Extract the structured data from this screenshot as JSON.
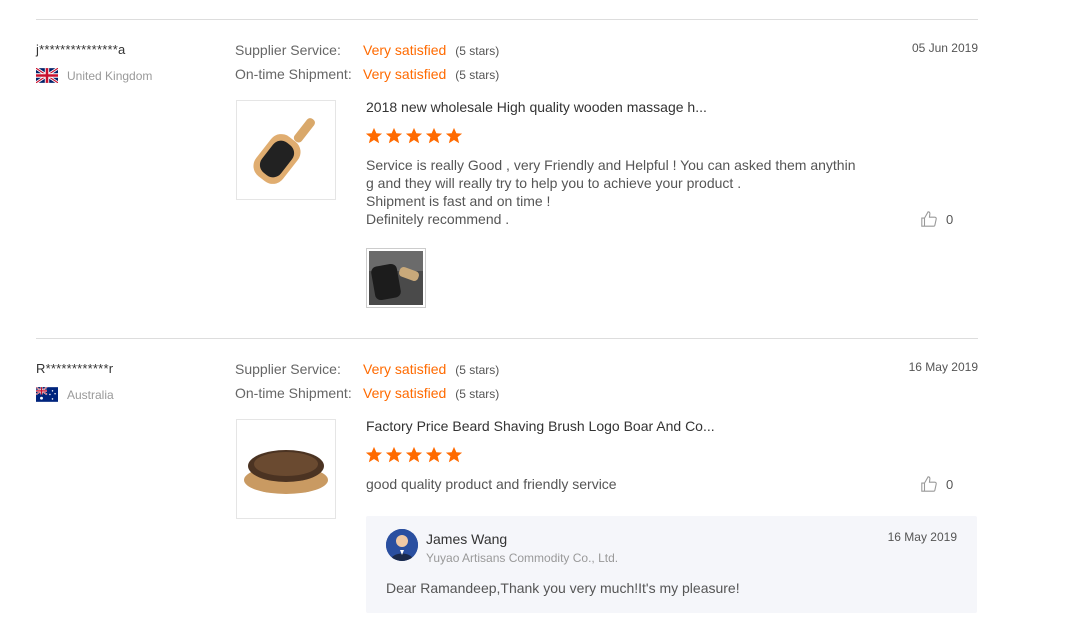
{
  "reviews": [
    {
      "user": "j***************a",
      "country": "United Kingdom",
      "flag": "uk-flag-icon",
      "date": "05 Jun 2019",
      "supplier_service_label": "Supplier Service:",
      "supplier_service_value": "Very satisfied",
      "supplier_service_stars": "(5 stars)",
      "shipment_label": "On-time Shipment:",
      "shipment_value": "Very satisfied",
      "shipment_stars": "(5 stars)",
      "product_title": "2018 new wholesale High quality wooden massage h...",
      "rating": 5,
      "text_lines": [
        "Service is really Good , very Friendly  and Helpful ! You can asked them anythin",
        "g and they will really try to help you to achieve your product .",
        "Shipment is fast and on time !",
        "Definitely recommend ."
      ],
      "likes": "0"
    },
    {
      "user": "R************r",
      "country": "Australia",
      "flag": "australia-flag-icon",
      "date": "16 May 2019",
      "supplier_service_label": "Supplier Service:",
      "supplier_service_value": "Very satisfied",
      "supplier_service_stars": "(5 stars)",
      "shipment_label": "On-time Shipment:",
      "shipment_value": "Very satisfied",
      "shipment_stars": "(5 stars)",
      "product_title": "Factory Price Beard Shaving Brush Logo Boar And Co...",
      "rating": 5,
      "text_lines": [
        "good quality product and friendly service"
      ],
      "likes": "0",
      "reply": {
        "name": "James Wang",
        "company": "Yuyao Artisans Commodity Co., Ltd.",
        "date": "16 May 2019",
        "message": "Dear Ramandeep,Thank you very much!It's my pleasure!"
      }
    }
  ],
  "colors": {
    "accent": "#ff6a00",
    "divider": "#dddddd",
    "reply_bg": "#f5f6fa"
  }
}
